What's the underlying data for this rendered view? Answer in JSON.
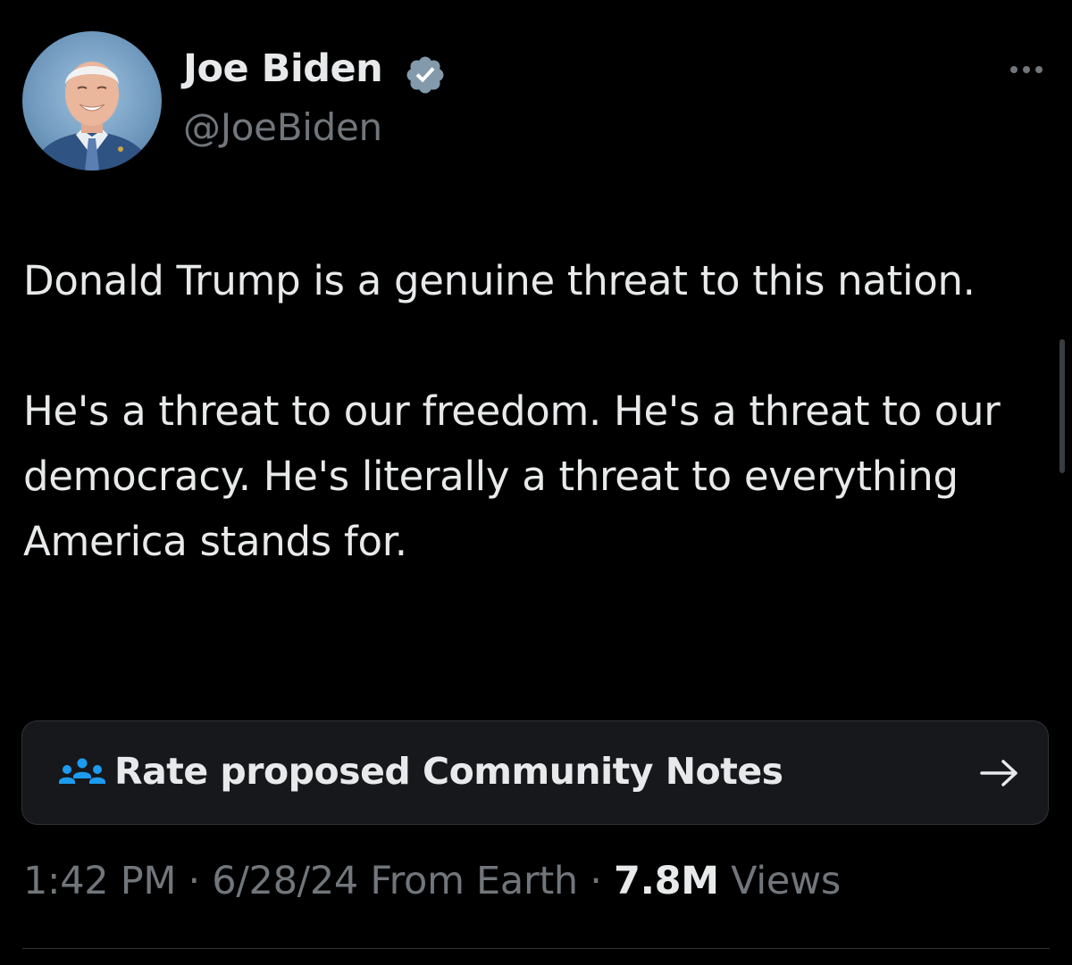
{
  "tweet": {
    "author": {
      "display_name": "Joe Biden",
      "handle": "@JoeBiden",
      "verified": true,
      "avatar": "profile-photo"
    },
    "text": {
      "paragraph_1": "Donald Trump is a genuine threat to this nation.",
      "paragraph_2": "He's a threat to our freedom. He's a threat to our democracy. He's literally a threat to everything America stands for."
    },
    "community_notes": {
      "label": "Rate proposed Community Notes",
      "icon": "people-group-icon",
      "arrow": "→"
    },
    "meta": {
      "time": "1:42 PM",
      "sep1": " · ",
      "date": "6/28/24",
      "source": " From Earth",
      "sep2": " · ",
      "views_count": "7.8M",
      "views_label": " Views"
    },
    "more_menu": "more-options-icon"
  },
  "colors": {
    "background": "#000000",
    "primary_text": "#e7e9ea",
    "secondary_text": "#71767b",
    "card_background": "#16181c",
    "accent_blue": "#1d9bf0",
    "verified_badge": "#829aab"
  }
}
